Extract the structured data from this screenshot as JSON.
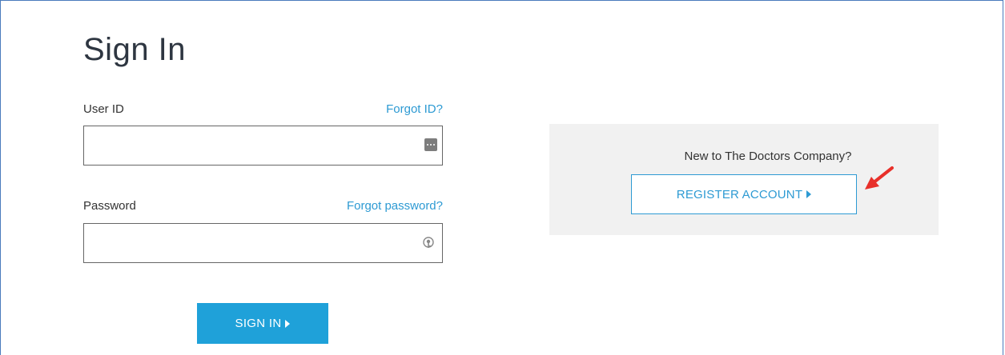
{
  "page": {
    "title": "Sign In"
  },
  "form": {
    "user_id_label": "User ID",
    "forgot_id_link": "Forgot ID?",
    "user_id_value": "",
    "password_label": "Password",
    "forgot_password_link": "Forgot password?",
    "password_value": "",
    "sign_in_button": "SIGN IN"
  },
  "register_panel": {
    "question": "New to The Doctors Company?",
    "register_button": "REGISTER ACCOUNT"
  },
  "icons": {
    "user_id_field": "password-manager-dots-icon",
    "password_field": "key-icon",
    "annotation": "red-arrow-icon"
  },
  "colors": {
    "accent": "#1fa1d9",
    "link": "#2d9ad3",
    "panel_bg": "#f1f1f1",
    "annotation": "#e8302a"
  }
}
